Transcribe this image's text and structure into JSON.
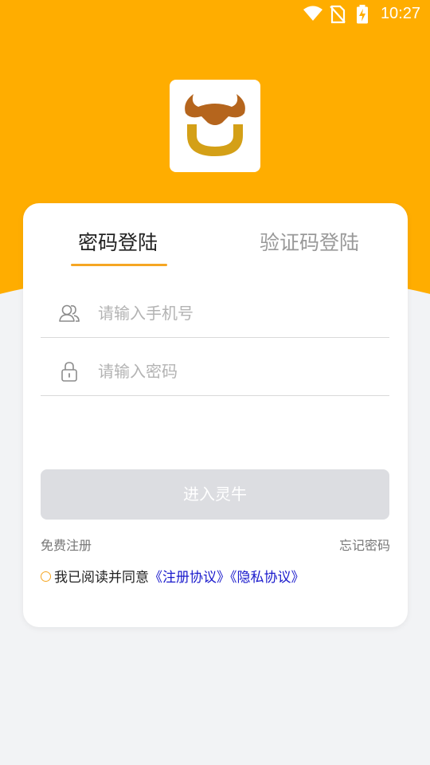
{
  "status_bar": {
    "time": "10:27",
    "icons": [
      "wifi-icon",
      "no-sim-icon",
      "battery-charging-icon"
    ]
  },
  "logo": {
    "icon": "bull-logo-icon",
    "colors": {
      "horns": "#b5651d",
      "horseshoe": "#d4a017"
    }
  },
  "tabs": [
    {
      "label": "密码登陆",
      "active": true
    },
    {
      "label": "验证码登陆",
      "active": false
    }
  ],
  "form": {
    "phone_placeholder": "请输入手机号",
    "password_placeholder": "请输入密码",
    "phone_icon": "users-icon",
    "password_icon": "lock-icon"
  },
  "login_button": "进入灵牛",
  "links": {
    "register": "免费注册",
    "forgot": "忘记密码"
  },
  "agreement": {
    "text": "我已阅读并同意",
    "register_agreement": "《注册协议》",
    "privacy_agreement": "《隐私协议》"
  },
  "colors": {
    "accent": "#ffad00",
    "tab_underline": "#f5a623",
    "link": "#1a1acc",
    "button_disabled": "#dcdde1"
  }
}
